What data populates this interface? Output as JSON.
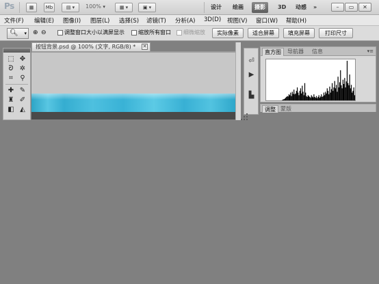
{
  "appbar": {
    "logo": "Ps",
    "mb_label": "Mb",
    "zoom_value": "100%",
    "workspaces": [
      "设计",
      "绘画",
      "摄影",
      "3D",
      "动感"
    ],
    "active_workspace": "摄影",
    "more_label": "»",
    "window_controls": [
      "minimize-icon",
      "restore-icon",
      "close-icon"
    ]
  },
  "menubar": {
    "items": [
      "文件(F)",
      "编辑(E)",
      "图像(I)",
      "图层(L)",
      "选择(S)",
      "滤镜(T)",
      "分析(A)",
      "3D(D)",
      "视图(V)",
      "窗口(W)",
      "帮助(H)"
    ]
  },
  "options": {
    "checkbox1_label": "调整窗口大小以满屏显示",
    "checkbox2_label": "缩放所有窗口",
    "checkbox3_label": "细微缩放",
    "btn_actual": "实际像素",
    "btn_fit": "适合屏幕",
    "btn_fill": "填充屏幕",
    "btn_print": "打印尺寸"
  },
  "document": {
    "tab_title": "按钮背景.psd @ 100% (文字, RGB/8) *",
    "close_label": "✕"
  },
  "histogram_panel": {
    "tabs": [
      "直方图",
      "导航器",
      "信息"
    ],
    "active_tab": "直方图",
    "menu_label": "▾≡",
    "levels": [
      0,
      0,
      0,
      0,
      0,
      0,
      0,
      0,
      0,
      0,
      0,
      0,
      0,
      0,
      0,
      0,
      0,
      0,
      0,
      1,
      2,
      3,
      4,
      6,
      8,
      10,
      9,
      14,
      12,
      18,
      10,
      20,
      15,
      25,
      14,
      16,
      22,
      30,
      18,
      12,
      22,
      28,
      16,
      34,
      20,
      12,
      40,
      18,
      10,
      8,
      12,
      10,
      8,
      6,
      12,
      9,
      7,
      14,
      8,
      6,
      10,
      5,
      8,
      12,
      6,
      9,
      14,
      8,
      10,
      18,
      12,
      20,
      16,
      28,
      22,
      14,
      32,
      18,
      26,
      40,
      22,
      30,
      45,
      28,
      36,
      20,
      55,
      30,
      42,
      70,
      35,
      28,
      48,
      38,
      52,
      30,
      44,
      92,
      40,
      35,
      60,
      28,
      36,
      18,
      22,
      30,
      12
    ]
  },
  "adjust_panel": {
    "tabs": [
      "调整",
      "蒙版"
    ],
    "active_tab": "调整"
  },
  "colors": {
    "banner": "#3cb4d6",
    "canvas_bg": "#c7c7c7",
    "workspace_bg": "#808080"
  }
}
